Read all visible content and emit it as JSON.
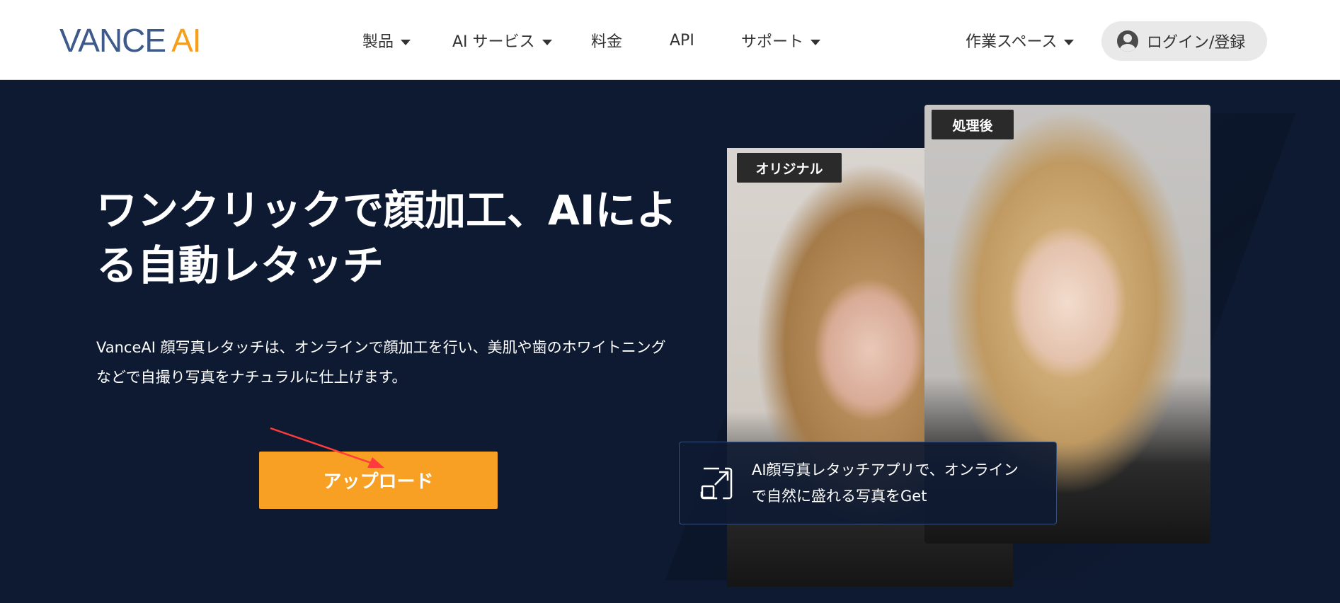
{
  "header": {
    "logo": {
      "part1": "VANCE",
      "part2": "AI"
    },
    "nav": [
      {
        "label": "製品",
        "has_caret": true
      },
      {
        "label": "AI サービス",
        "has_caret": true
      },
      {
        "label": "料金",
        "has_caret": false
      },
      {
        "label": "API",
        "has_caret": false
      },
      {
        "label": "サポート",
        "has_caret": true
      }
    ],
    "workspace": {
      "label": "作業スペース"
    },
    "login": {
      "label": "ログイン/登録"
    }
  },
  "hero": {
    "title_line1": "ワンクリックで顔加工、AIによ",
    "title_line2": "る自動レタッチ",
    "description_line1": "VanceAI 顔写真レタッチは、オンラインで顔加工を行い、美肌や歯のホワイトニング",
    "description_line2": "などで自撮り写真をナチュラルに仕上げます。",
    "upload_label": "アップロード"
  },
  "comparison": {
    "original_tag": "オリジナル",
    "after_tag": "処理後",
    "caption_line1": "AI顔写真レタッチアプリで、オンライン",
    "caption_line2": "で自然に盛れる写真をGet"
  },
  "colors": {
    "brand_blue": "#3d5a8a",
    "brand_orange": "#f5a01c",
    "hero_bg": "#0e1a32",
    "upload_button": "#f7a024"
  },
  "icons": {
    "expand": "expand-icon",
    "user": "user-avatar-icon",
    "dropdown": "chevron-down-icon"
  }
}
